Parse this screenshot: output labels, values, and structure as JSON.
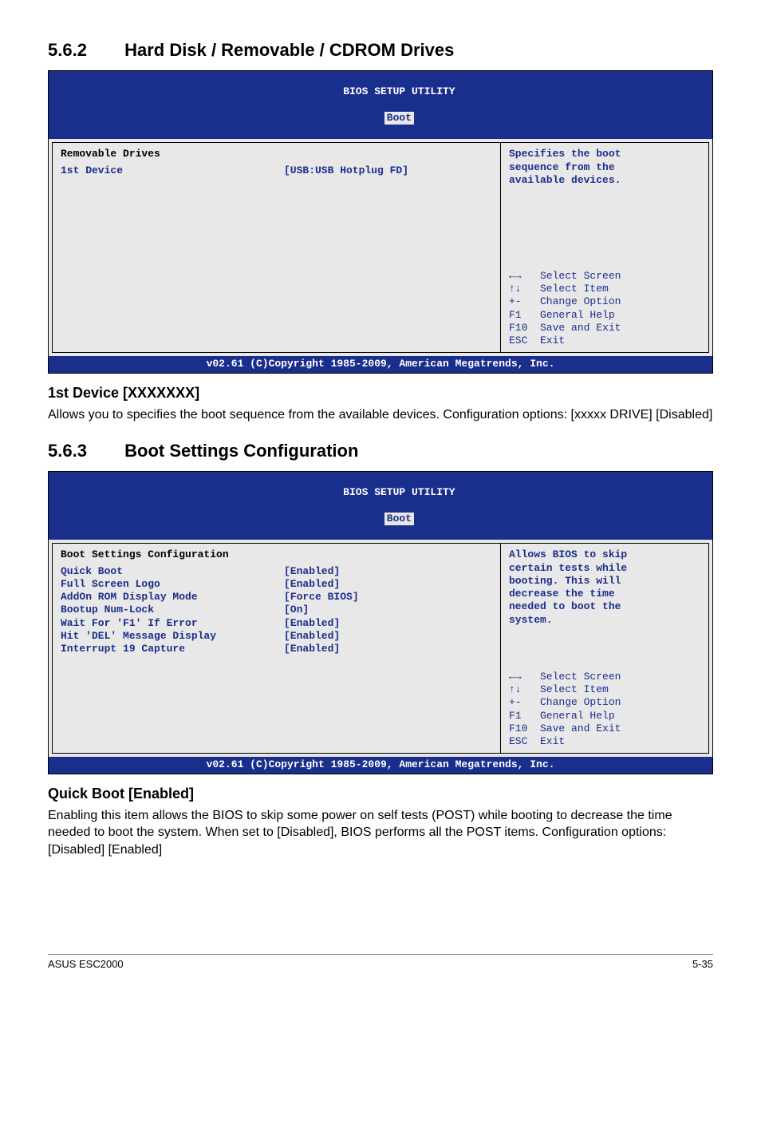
{
  "sec562": {
    "num": "5.6.2",
    "title": "Hard Disk / Removable / CDROM Drives"
  },
  "bios1": {
    "headerLine1": "BIOS SETUP UTILITY",
    "tab": "Boot",
    "leftHeading": "Removable Drives",
    "rows": [
      {
        "label": "1st Device",
        "value": "[USB:USB Hotplug FD]"
      }
    ],
    "help": "Specifies the boot\nsequence from the\navailable devices.",
    "keys": "←→   Select Screen\n↑↓   Select Item\n+-   Change Option\nF1   General Help\nF10  Save and Exit\nESC  Exit",
    "copyright": "v02.61 (C)Copyright 1985-2009, American Megatrends, Inc."
  },
  "firstDevice": {
    "head": "1st Device [XXXXXXX]",
    "para": "Allows you to specifies the boot sequence from the available devices. Configuration options: [xxxxx DRIVE] [Disabled]"
  },
  "sec563": {
    "num": "5.6.3",
    "title": "Boot Settings Configuration"
  },
  "bios2": {
    "headerLine1": "BIOS SETUP UTILITY",
    "tab": "Boot",
    "leftHeading": "Boot Settings Configuration",
    "rows": [
      {
        "label": "Quick Boot",
        "value": "[Enabled]"
      },
      {
        "label": "Full Screen Logo",
        "value": "[Enabled]"
      },
      {
        "label": "AddOn ROM Display Mode",
        "value": "[Force BIOS]"
      },
      {
        "label": "Bootup Num-Lock",
        "value": "[On]"
      },
      {
        "label": "Wait For 'F1' If Error",
        "value": "[Enabled]"
      },
      {
        "label": "Hit 'DEL' Message Display",
        "value": "[Enabled]"
      },
      {
        "label": "Interrupt 19 Capture",
        "value": "[Enabled]"
      }
    ],
    "help": "Allows BIOS to skip\ncertain tests while\nbooting. This will\ndecrease the time\nneeded to boot the\nsystem.",
    "keys": "←→   Select Screen\n↑↓   Select Item\n+-   Change Option\nF1   General Help\nF10  Save and Exit\nESC  Exit",
    "copyright": "v02.61 (C)Copyright 1985-2009, American Megatrends, Inc."
  },
  "quickBoot": {
    "head": "Quick Boot [Enabled]",
    "para": "Enabling this item allows the BIOS to skip some power on self tests (POST) while booting to decrease the time needed to boot the system. When set to [Disabled], BIOS performs all the POST items. Configuration options: [Disabled] [Enabled]"
  },
  "footer": {
    "left": "ASUS ESC2000",
    "right": "5-35"
  }
}
